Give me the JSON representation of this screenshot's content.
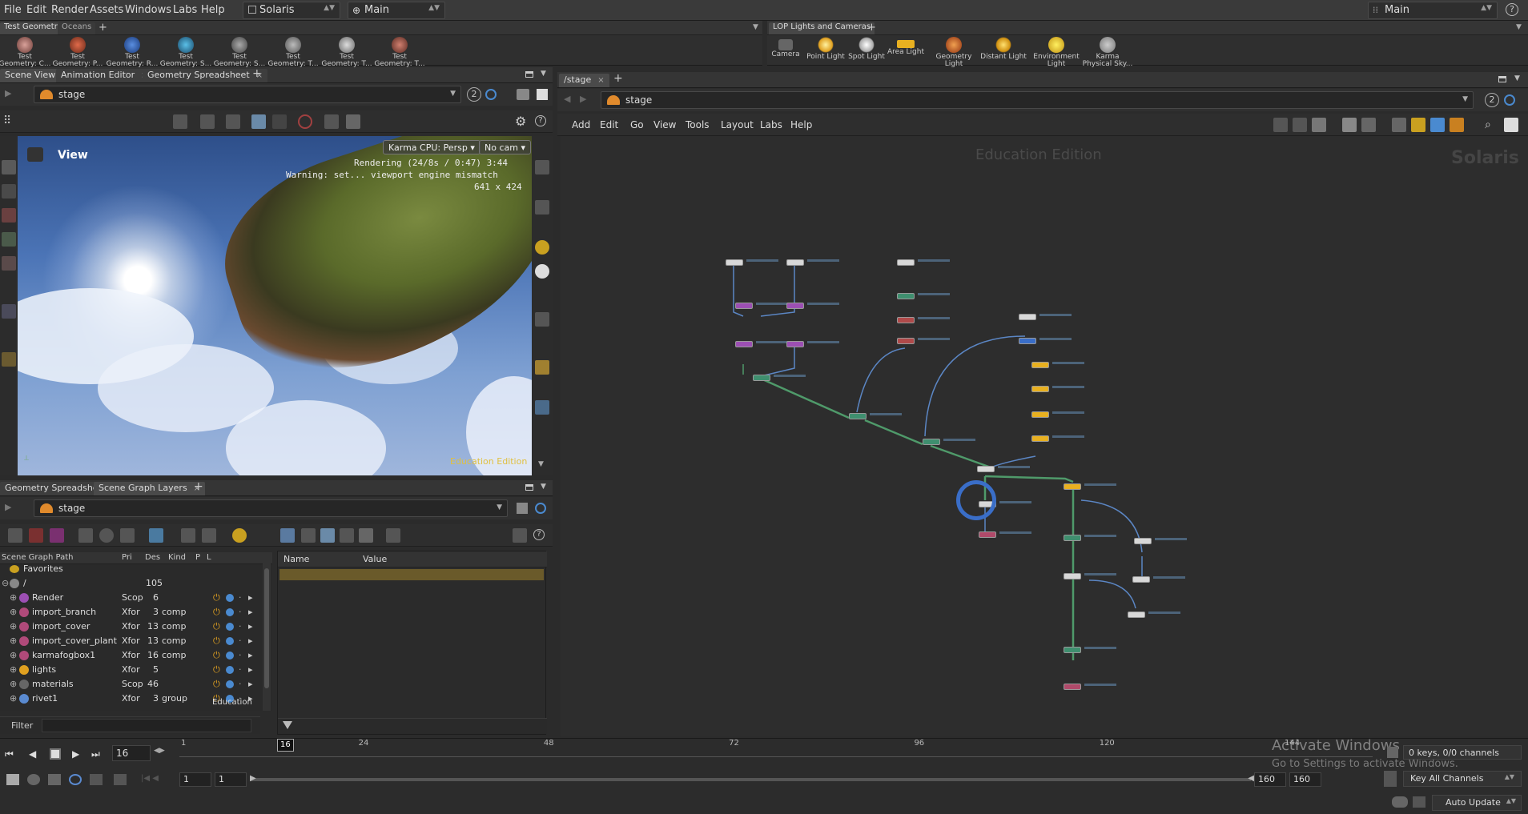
{
  "menubar": {
    "items": [
      "File",
      "Edit",
      "Render",
      "Assets",
      "Windows",
      "Labs",
      "Help"
    ],
    "desktop": "Solaris",
    "context": "Main",
    "right_desktop": "Main",
    "help_icon": "?"
  },
  "shelf_left": {
    "tabs": [
      "Test Geometry",
      "Oceans"
    ],
    "add": "+",
    "tools": [
      "Test Geometry: C...",
      "Test Geometry: P...",
      "Test Geometry: R...",
      "Test Geometry: S...",
      "Test Geometry: S...",
      "Test Geometry: T...",
      "Test Geometry: T...",
      "Test Geometry: T..."
    ]
  },
  "shelf_right": {
    "tabs": [
      "LOP Lights and Cameras"
    ],
    "add": "+",
    "tools": [
      "Camera",
      "Point Light",
      "Spot Light",
      "Area Light",
      "Geometry Light",
      "Distant Light",
      "Environment Light",
      "Karma Physical Sky..."
    ]
  },
  "viewer_pane": {
    "tabs": [
      "Scene View",
      "Animation Editor",
      "Geometry Spreadsheet"
    ],
    "path": "stage",
    "badge": "2",
    "view_label": "View",
    "renderer_menu": "Karma CPU: Persp",
    "camera_menu": "No cam",
    "overlay_line1": "Rendering (24/8s / 0:47) 3:44",
    "overlay_line2": "Warning: set... viewport engine mismatch",
    "overlay_line3": "641 x 424",
    "watermark": "Education Edition"
  },
  "tree_pane": {
    "tabs": [
      "Geometry Spreadsheet",
      "Scene Graph Layers"
    ],
    "path": "stage",
    "columns": [
      "Scene Graph Path",
      "Pri",
      "Des",
      "Kind",
      "P",
      "L"
    ],
    "favorites": "Favorites",
    "root": {
      "name": "/",
      "des": "105"
    },
    "rows": [
      {
        "name": "Render",
        "pri": "Scop",
        "des": "6",
        "kind": ""
      },
      {
        "name": "import_branch",
        "pri": "Xfor",
        "des": "3",
        "kind": "comp"
      },
      {
        "name": "import_cover",
        "pri": "Xfor",
        "des": "13",
        "kind": "comp"
      },
      {
        "name": "import_cover_plant",
        "pri": "Xfor",
        "des": "13",
        "kind": "comp"
      },
      {
        "name": "karmafogbox1",
        "pri": "Xfor",
        "des": "16",
        "kind": "comp"
      },
      {
        "name": "lights",
        "pri": "Xfor",
        "des": "5",
        "kind": ""
      },
      {
        "name": "materials",
        "pri": "Scop",
        "des": "46",
        "kind": ""
      },
      {
        "name": "rivet1",
        "pri": "Xfor",
        "des": "3",
        "kind": "group"
      }
    ],
    "filter_label": "Filter",
    "edu": "Education"
  },
  "details_pane": {
    "columns": [
      "Name",
      "Value"
    ]
  },
  "network_pane": {
    "tab": "/stage",
    "add": "+",
    "path": "stage",
    "badge": "2",
    "menu": [
      "Add",
      "Edit",
      "Go",
      "View",
      "Tools",
      "Layout",
      "Labs",
      "Help"
    ],
    "edu_watermark": "Education Edition",
    "context_watermark": "Solaris"
  },
  "timeline": {
    "current_frame": "16",
    "ticks": [
      "1",
      "24",
      "48",
      "72",
      "96",
      "120",
      "144"
    ],
    "marker": "16",
    "start": "1",
    "start2": "1",
    "end": "160",
    "end2": "160",
    "keys": "0 keys, 0/0 channels",
    "key_all": "Key All Channels",
    "auto_update": "Auto Update",
    "activate_line1": "Activate Windows",
    "activate_line2": "Go to Settings to activate Windows."
  },
  "colors": {
    "accent_orange": "#e08a2c",
    "node_light": "#e8b020",
    "node_purple": "#9c4fb3",
    "node_green": "#3f8f6f",
    "wire_green": "#4f9a6a",
    "wire_blue": "#5b86c4"
  }
}
